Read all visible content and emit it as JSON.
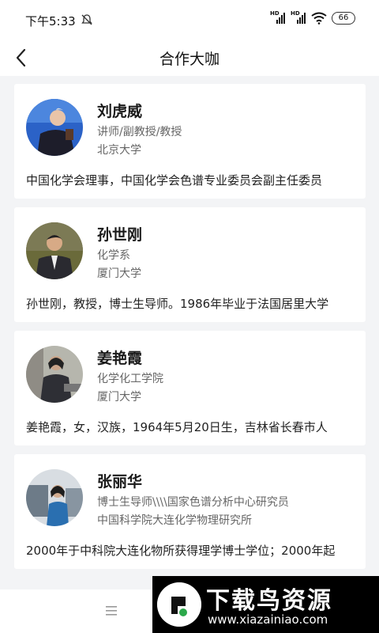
{
  "status_bar": {
    "time": "下午5:33",
    "signal1": "HD",
    "signal2": "HD",
    "battery": "66"
  },
  "header": {
    "title": "合作大咖"
  },
  "experts": [
    {
      "name": "刘虎威",
      "line1": "讲师/副教授/教授",
      "line2": "北京大学",
      "desc": "中国化学会理事，中国化学会色谱专业委员会副主任委员"
    },
    {
      "name": "孙世刚",
      "line1": "化学系",
      "line2": "厦门大学",
      "desc": "孙世刚，教授，博士生导师。1986年毕业于法国居里大学"
    },
    {
      "name": "姜艳霞",
      "line1": "化学化工学院",
      "line2": "厦门大学",
      "desc": "姜艳霞，女，汉族，1964年5月20日生，吉林省长春市人"
    },
    {
      "name": "张丽华",
      "line1": "博士生导师\\\\\\\\国家色谱分析中心研究员",
      "line2": "中国科学院大连化学物理研究所",
      "desc": "2000年于中科院大连化物所获得理学博士学位；2000年起"
    }
  ],
  "bottom_bar": {
    "menu_icon": "menu-icon"
  },
  "watermark": {
    "title": "下载鸟资源",
    "url": "www.xiazainiao.com"
  }
}
